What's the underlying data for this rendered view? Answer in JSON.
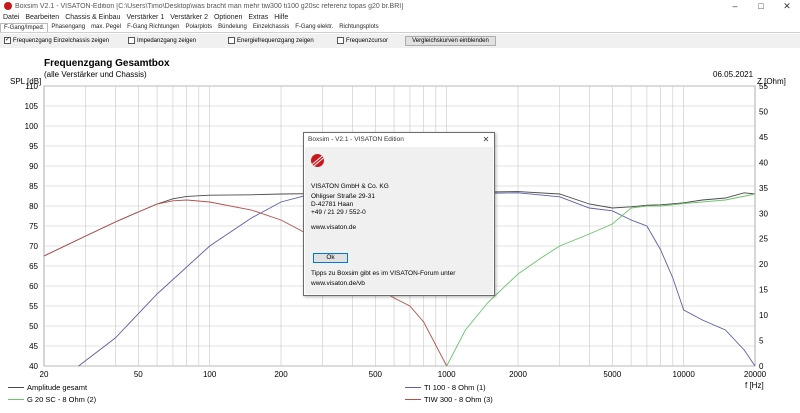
{
  "window": {
    "title": "Boxsim V2.1 - VISATON-Edition [C:\\Users\\Timo\\Desktop\\was bracht man mehr tiw300 ti100 g20sc referenz topas g20 br.BRI]",
    "minimize": "–",
    "maximize": "□",
    "close": "✕"
  },
  "menu": [
    "Datei",
    "Bearbeiten",
    "Chassis & Einbau",
    "Verstärker 1",
    "Verstärker 2",
    "Optionen",
    "Extras",
    "Hilfe"
  ],
  "tabs": [
    "F-Gang/Imped.",
    "Phasengang",
    "max. Pegel",
    "F-Gang Richtungen",
    "Polarplots",
    "Bündelung",
    "Einzelchassis",
    "F-Gang elektr.",
    "Richtungsplots"
  ],
  "options": {
    "einzelchassis": {
      "label": "Frequenzgang Einzelchassis zeigen",
      "checked": "✓"
    },
    "impedanz": {
      "label": "Impedanzgang zeigen"
    },
    "energie": {
      "label": "Energiefrequenzgang zeigen"
    },
    "cursor": {
      "label": "Frequenzcursor"
    },
    "vergleich": {
      "label": "Vergleichskurven einblenden"
    }
  },
  "chart_header": {
    "title": "Frequenzgang Gesamtbox",
    "subtitle": "(alle Verstärker und Chassis)",
    "date": "06.05.2021"
  },
  "chart_data": {
    "type": "line",
    "ylabel": "SPL [dB]",
    "y2label": "Z [Ohm]",
    "xlabel": "f [Hz]",
    "xscale": "log",
    "xlim": [
      20,
      20000
    ],
    "ylim": [
      40,
      110
    ],
    "y2lim": [
      0,
      55
    ],
    "grid": true,
    "x_ticks": [
      "20",
      "50",
      "100",
      "200",
      "500",
      "1000",
      "2000",
      "5000",
      "10000",
      "20000"
    ],
    "y_ticks": [
      "40",
      "45",
      "50",
      "55",
      "60",
      "65",
      "70",
      "75",
      "80",
      "85",
      "90",
      "95",
      "100",
      "105",
      "110"
    ],
    "y2_ticks": [
      "0",
      "5",
      "10",
      "15",
      "20",
      "25",
      "30",
      "35",
      "40",
      "45",
      "50",
      "55"
    ],
    "series": [
      {
        "name": "Amplitude gesamt",
        "color": "#4a4a4a",
        "x": [
          20,
          30,
          40,
          50,
          60,
          70,
          80,
          100,
          150,
          200,
          300,
          500,
          1000,
          1500,
          2000,
          3000,
          4000,
          5000,
          6000,
          7000,
          8000,
          10000,
          12000,
          15000,
          18000,
          20000
        ],
        "y": [
          67.5,
          72.5,
          76.0,
          78.5,
          80.5,
          81.8,
          82.4,
          82.7,
          82.8,
          83.0,
          83.1,
          83.3,
          83.4,
          83.5,
          83.6,
          83.0,
          80.5,
          79.5,
          79.8,
          80.2,
          80.3,
          80.8,
          81.5,
          82.0,
          83.3,
          83.0
        ]
      },
      {
        "name": "TI 100 - 8 Ohm (1)",
        "color": "#5b5fa8",
        "x": [
          28,
          40,
          60,
          100,
          150,
          200,
          250,
          300,
          500,
          1000,
          2000,
          3000,
          4000,
          5000,
          6000,
          7000,
          8000,
          9000,
          10000,
          12000,
          15000,
          18000,
          20000
        ],
        "y": [
          40,
          47,
          58,
          70,
          77,
          81,
          82.5,
          82.8,
          82.9,
          83.0,
          83.3,
          82.3,
          79.5,
          78.8,
          76.5,
          75.0,
          69.0,
          62.0,
          54.0,
          51.5,
          49.0,
          44.0,
          40
        ]
      },
      {
        "name": "G 20 SC - 8 Ohm (2)",
        "color": "#6ac46a",
        "x": [
          1000,
          1200,
          1500,
          2000,
          2500,
          3000,
          4000,
          5000,
          6000,
          7000,
          8000,
          10000,
          15000,
          20000
        ],
        "y": [
          40,
          49,
          56,
          63,
          67,
          70,
          73,
          75.5,
          79.5,
          80,
          80,
          80.6,
          81.5,
          83
        ]
      },
      {
        "name": "TIW 300 - 8 Ohm (3)",
        "color": "#b5504a",
        "x": [
          20,
          30,
          40,
          50,
          60,
          70,
          80,
          100,
          150,
          200,
          300,
          400,
          500,
          600,
          700,
          800,
          1000
        ],
        "y": [
          67.5,
          72.5,
          76.0,
          78.5,
          80.5,
          81.3,
          81.5,
          81.0,
          79.0,
          76.5,
          71.0,
          65.5,
          60,
          57,
          55,
          51,
          40
        ]
      }
    ]
  },
  "legend": [
    {
      "label": "Amplitude gesamt",
      "color": "#4a4a4a"
    },
    {
      "label": "G 20 SC - 8 Ohm (2)",
      "color": "#6ac46a"
    },
    {
      "label": "TI 100 - 8 Ohm (1)",
      "color": "#5b5fa8"
    },
    {
      "label": "TIW 300 - 8 Ohm (3)",
      "color": "#b5504a"
    }
  ],
  "dialog": {
    "title": "Boxsim - V2.1 - VISATON Edition",
    "close": "✕",
    "company": "VISATON GmbH & Co. KG",
    "street": "Ohligser Straße 29-31",
    "city": "D-42781 Haan",
    "phone": "+49 / 21 29 / 552-0",
    "web": "www.visaton.de",
    "ok": "Ok",
    "tips": "Tipps zu Boxsim gibt es im VISATON-Forum unter",
    "forum": "www.visaton.de/vb"
  }
}
